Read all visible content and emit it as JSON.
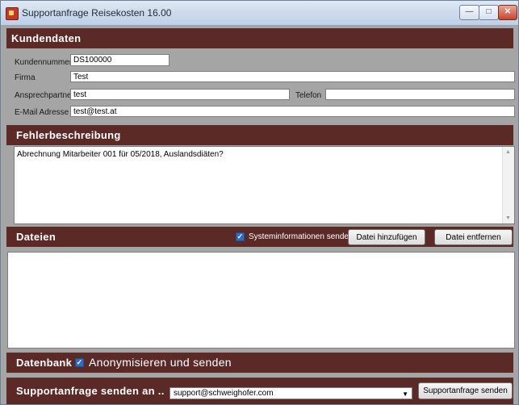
{
  "window": {
    "title": "Supportanfrage Reisekosten 16.00",
    "min_glyph": "—",
    "max_glyph": "□",
    "close_glyph": "✕"
  },
  "kundendaten": {
    "header": "Kundendaten",
    "kundennummer_label": "Kundennummer",
    "kundennummer_value": "DS100000",
    "firma_label": "Firma",
    "firma_value": "Test",
    "ansprechpartner_label": "Ansprechpartner",
    "ansprechpartner_value": "test",
    "telefon_label": "Telefon",
    "telefon_value": "",
    "email_label": "E-Mail Adresse",
    "email_value": "test@test.at"
  },
  "fehlerbeschreibung": {
    "header": "Fehlerbeschreibung",
    "text": "Abrechnung Mitarbeiter 001 für 05/2018, Auslandsdiäten?"
  },
  "dateien": {
    "header": "Dateien",
    "systeminfo_label": "Systeminformationen senden",
    "systeminfo_checked": true,
    "add_button": "Datei hinzufügen",
    "remove_button": "Datei entfernen"
  },
  "datenbank": {
    "label": "Datenbank",
    "checkbox_label": "Anonymisieren und senden",
    "checked": true
  },
  "send": {
    "label": "Supportanfrage senden an ..",
    "selected_address": "support@schweighofer.com",
    "button": "Supportanfrage senden"
  },
  "colors": {
    "section_header": "#5b2a26",
    "body_bg": "#a5a5a5",
    "checkbox": "#2e6dc4"
  }
}
